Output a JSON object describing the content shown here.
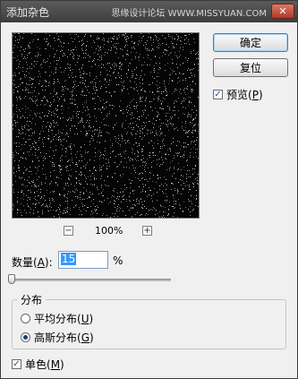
{
  "window": {
    "title": "添加杂色",
    "watermark": "思缘设计论坛 WWW.MISSYUAN.COM",
    "close_glyph": "✕"
  },
  "preview": {
    "zoom_out": "−",
    "zoom_in": "+",
    "zoom_level": "100%"
  },
  "buttons": {
    "ok": "确定",
    "reset": "复位"
  },
  "preview_checkbox": {
    "label": "预览(",
    "accel": "P",
    "tail": ")",
    "checked": true
  },
  "amount": {
    "label": "数量(",
    "accel": "A",
    "tail": "):",
    "value": "15",
    "unit": "%"
  },
  "distribution": {
    "title": "分布",
    "uniform": {
      "label": "平均分布(",
      "accel": "U",
      "tail": ")",
      "selected": false
    },
    "gaussian": {
      "label": "高斯分布(",
      "accel": "G",
      "tail": ")",
      "selected": true
    }
  },
  "monochrome": {
    "label": "单色(",
    "accel": "M",
    "tail": ")",
    "checked": true
  },
  "colors": {
    "titlebar": "#4a4a4a",
    "preview_bg": "#050505",
    "noise": "#9a9a9a"
  }
}
